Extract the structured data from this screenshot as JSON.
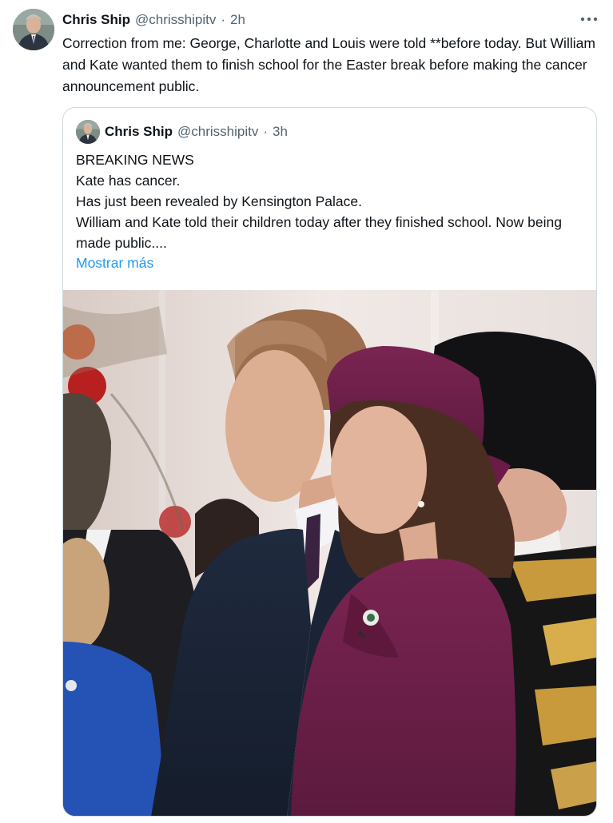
{
  "tweet": {
    "author_name": "Chris Ship",
    "author_handle": "@chrisshipitv",
    "separator": "·",
    "time": "2h",
    "more_icon": "more-horizontal-icon",
    "text": "Correction from me: George, Charlotte and Louis were told **before today. But William and Kate wanted them to finish school for the Easter break before making the cancer announcement public."
  },
  "quoted": {
    "author_name": "Chris Ship",
    "author_handle": "@chrisshipitv",
    "separator": "·",
    "time": "3h",
    "lines": [
      "BREAKING NEWS",
      "Kate has cancer.",
      "Has just been revealed by Kensington Palace.",
      "William and Kate told their children today after they finished school. Now being made public...."
    ],
    "show_more": "Mostrar más"
  },
  "colors": {
    "text": "#0f1419",
    "secondary": "#536471",
    "link": "#1d9bf0",
    "border": "#cfd9de",
    "plum_outfit": "#6e1f4a"
  }
}
